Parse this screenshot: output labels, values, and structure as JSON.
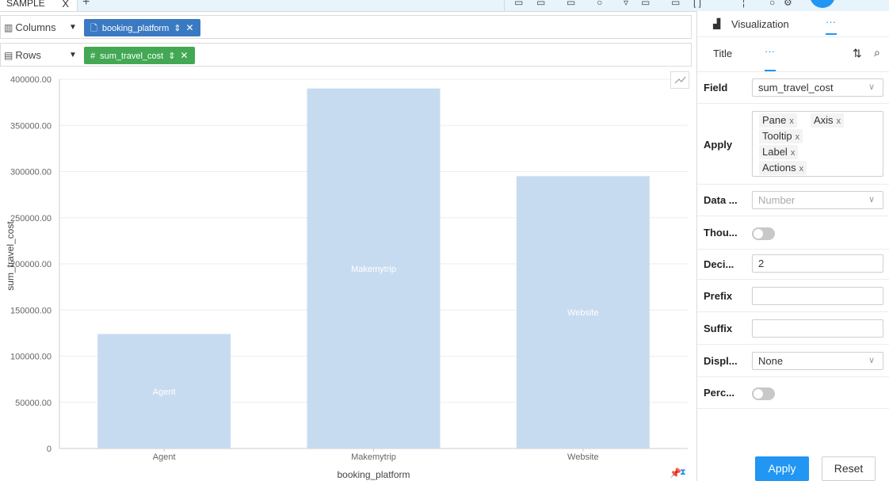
{
  "tabs": {
    "active_label": "SAMPLE",
    "close_symbol": "X",
    "add_symbol": "+"
  },
  "shelves": {
    "columns": {
      "label": "Columns",
      "icon": "columns-icon",
      "pill": {
        "label": "booking_platform",
        "color": "#3a7ac3",
        "icon": "file-icon"
      }
    },
    "rows": {
      "label": "Rows",
      "icon": "rows-icon",
      "pill": {
        "label": "sum_travel_cost",
        "color": "#43a854",
        "icon": "hash-icon",
        "icon_text": "#"
      }
    }
  },
  "chart_data": {
    "type": "bar",
    "categories": [
      "Agent",
      "Makemytrip",
      "Website"
    ],
    "values": [
      124000,
      390000,
      295000
    ],
    "data_labels": [
      "Agent",
      "Makemytrip",
      "Website"
    ],
    "xlabel": "booking_platform",
    "ylabel": "sum_travel_cost",
    "ylim": [
      0,
      400000
    ],
    "yticks": [
      "0",
      "50000.00",
      "100000.00",
      "150000.00",
      "200000.00",
      "250000.00",
      "300000.00",
      "350000.00",
      "400000.00"
    ],
    "bar_color": "#c7dbf0",
    "grid": true
  },
  "panel": {
    "tabs": [
      {
        "label": "Visualization",
        "icon": "bar-chart-icon"
      },
      {
        "label": "···"
      }
    ],
    "subtabs": [
      {
        "label": "Title"
      },
      {
        "label": "···"
      }
    ],
    "fields": {
      "field": {
        "label": "Field",
        "value": "sum_travel_cost"
      },
      "apply": {
        "label": "Apply",
        "tags": [
          "Pane",
          "Axis",
          "Tooltip",
          "Label",
          "Actions"
        ]
      },
      "data_type": {
        "label": "Data ...",
        "value": "Number"
      },
      "thousand": {
        "label": "Thou...",
        "on": false
      },
      "decimals": {
        "label": "Deci...",
        "value": "2"
      },
      "prefix": {
        "label": "Prefix",
        "value": ""
      },
      "suffix": {
        "label": "Suffix",
        "value": ""
      },
      "display": {
        "label": "Displ...",
        "value": "None"
      },
      "percent": {
        "label": "Perc...",
        "on": false
      }
    },
    "apply_button": "Apply",
    "reset_button": "Reset"
  }
}
